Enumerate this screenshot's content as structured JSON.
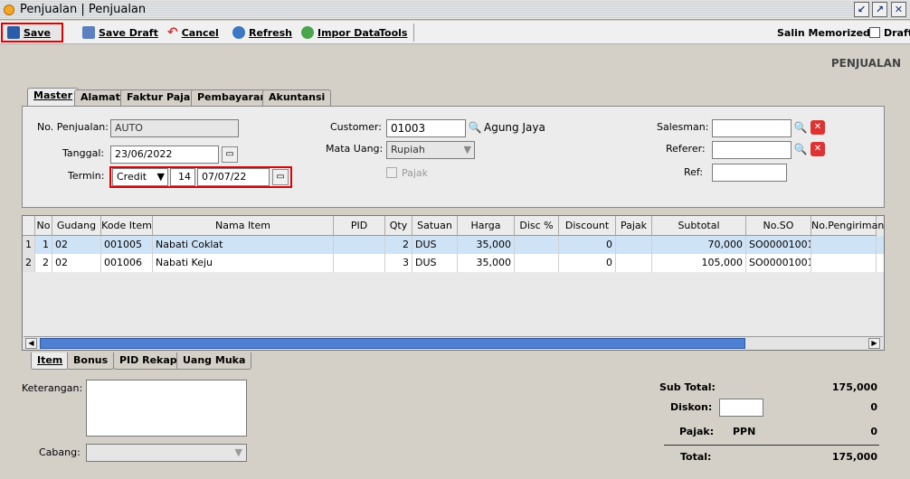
{
  "window": {
    "title": "Penjualan | Penjualan"
  },
  "toolbar": {
    "save": "Save",
    "save_draft": "Save Draft",
    "cancel": "Cancel",
    "refresh": "Refresh",
    "impor_data": "Impor Data",
    "tools": "Tools",
    "salin_memorized": "Salin Memorized",
    "draft": "Draft"
  },
  "page_title": "PENJUALAN",
  "tabs": [
    "Master",
    "Alamat",
    "Faktur Pajak",
    "Pembayaran",
    "Akuntansi"
  ],
  "master": {
    "no_penjualan_label": "No. Penjualan:",
    "no_penjualan": "AUTO",
    "tanggal_label": "Tanggal:",
    "tanggal": "23/06/2022",
    "termin_label": "Termin:",
    "termin_type": "Credit",
    "termin_days": "14",
    "termin_date": "07/07/22",
    "customer_label": "Customer:",
    "customer_code": "01003",
    "customer_name": "Agung Jaya",
    "mata_uang_label": "Mata Uang:",
    "mata_uang": "Rupiah",
    "pajak_label": "Pajak",
    "salesman_label": "Salesman:",
    "salesman": "",
    "referer_label": "Referer:",
    "referer": "",
    "ref_label": "Ref:",
    "ref": ""
  },
  "grid": {
    "headers": [
      "No",
      "Gudang",
      "Kode Item",
      "Nama Item",
      "PID",
      "Qty",
      "Satuan",
      "Harga",
      "Disc %",
      "Discount",
      "Pajak",
      "Subtotal",
      "No.SO",
      "No.Pengiriman"
    ],
    "rows": [
      {
        "idx": "1",
        "no": "1",
        "gudang": "02",
        "kode": "001005",
        "nama": "Nabati Coklat",
        "pid": "",
        "qty": "2",
        "satuan": "DUS",
        "harga": "35,000",
        "disc": "",
        "discount": "0",
        "pajak": "",
        "subtotal": "70,000",
        "so": "SO00001001",
        "kirim": ""
      },
      {
        "idx": "2",
        "no": "2",
        "gudang": "02",
        "kode": "001006",
        "nama": "Nabati Keju",
        "pid": "",
        "qty": "3",
        "satuan": "DUS",
        "harga": "35,000",
        "disc": "",
        "discount": "0",
        "pajak": "",
        "subtotal": "105,000",
        "so": "SO00001001",
        "kirim": ""
      }
    ]
  },
  "bottom_tabs": [
    "Item",
    "Bonus",
    "PID Rekap",
    "Uang Muka"
  ],
  "footer": {
    "keterangan_label": "Keterangan:",
    "cabang_label": "Cabang:",
    "sub_total_label": "Sub Total:",
    "sub_total": "175,000",
    "diskon_label": "Diskon:",
    "diskon": "0",
    "pajak_label": "Pajak:",
    "pajak_type": "PPN",
    "pajak": "0",
    "total_label": "Total:",
    "total": "175,000"
  }
}
